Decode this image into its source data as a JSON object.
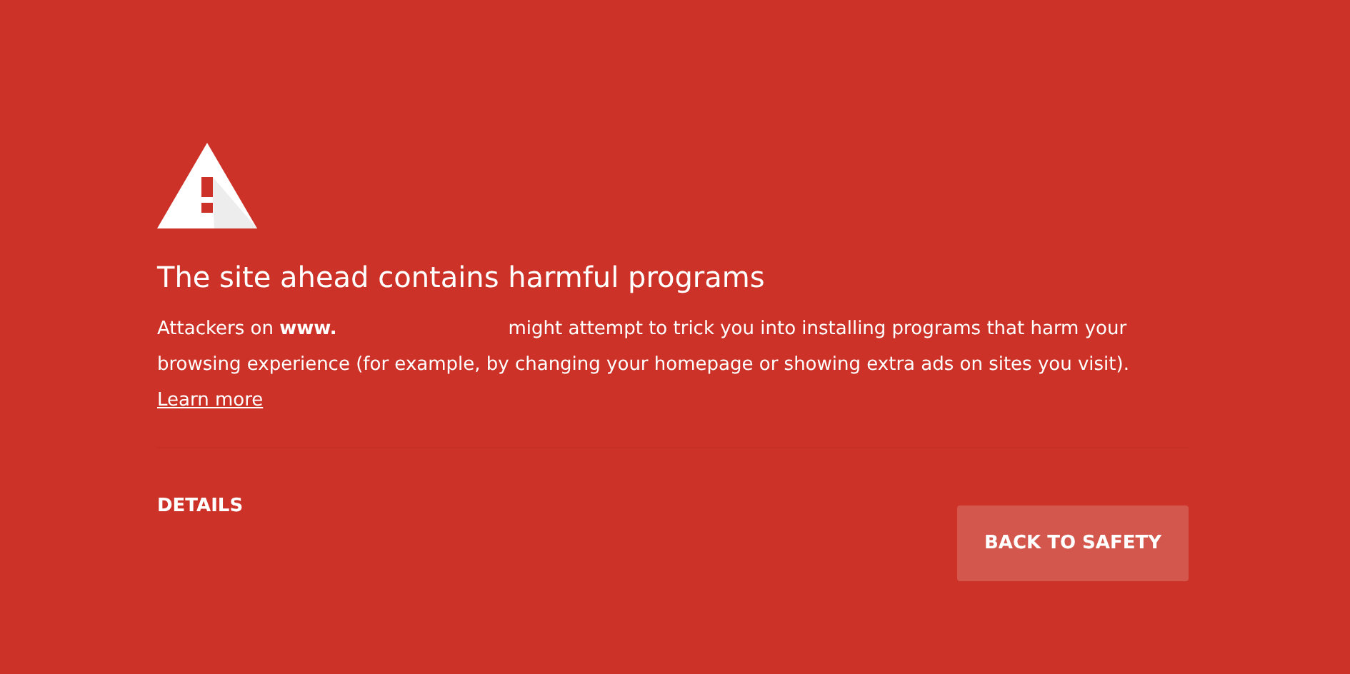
{
  "heading": "The site ahead contains harmful programs",
  "message": {
    "intro": "Attackers on **www.**",
    "body": "might attempt to trick you into installing programs that harm your browsing experience (for example, by changing your homepage or showing extra ads on sites you visit).",
    "link": "Learn more"
  },
  "buttons": [
    {
      "kind": "link",
      "label": "DETAILS"
    },
    {
      "kind": "primary",
      "label": "BACK TO SAFETY"
    }
  ]
}
